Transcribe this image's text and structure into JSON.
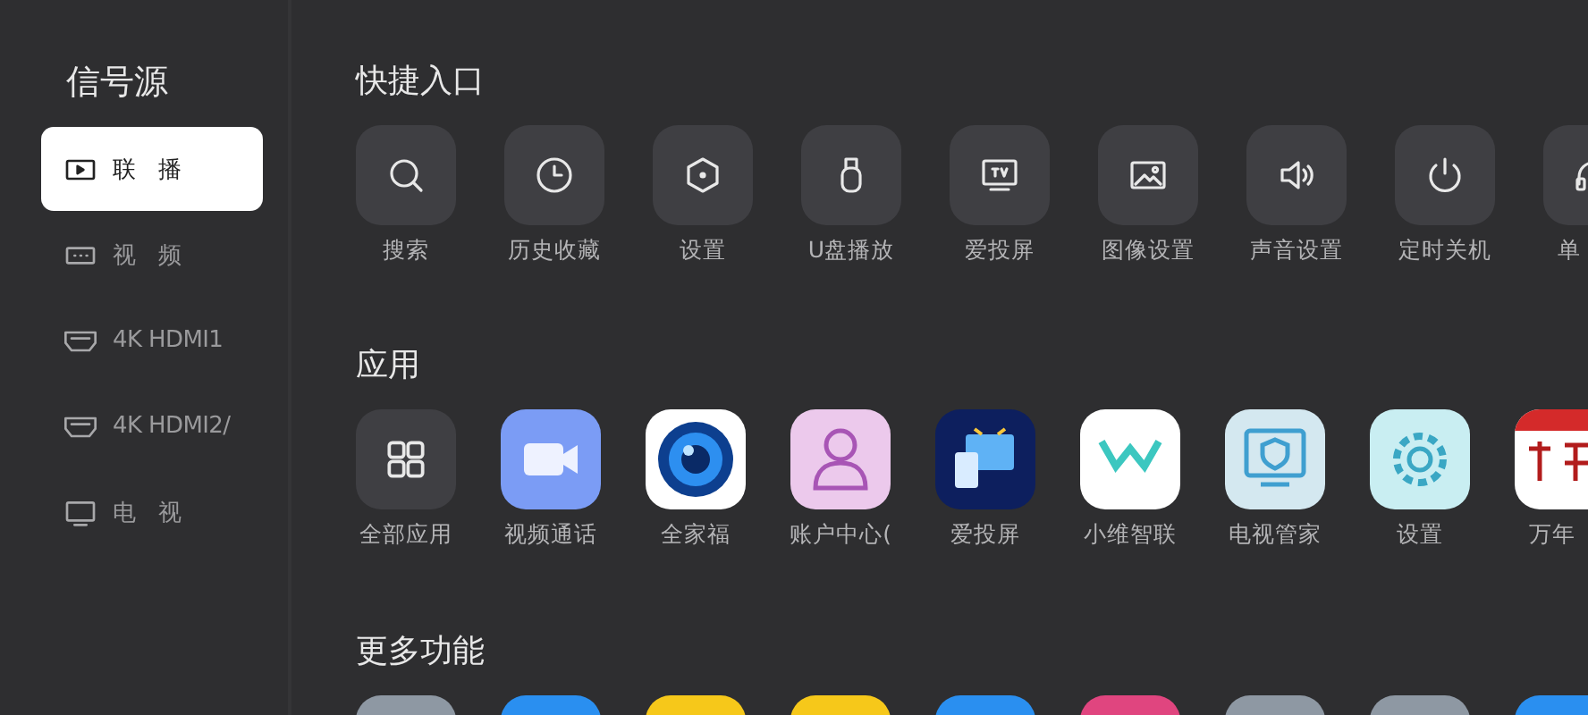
{
  "sidebar": {
    "title": "信号源",
    "items": [
      {
        "label": "联　播",
        "selected": true
      },
      {
        "label": "视　频",
        "selected": false
      },
      {
        "label": "4K HDMI1",
        "selected": false
      },
      {
        "label": "4K HDMI2/",
        "selected": false
      },
      {
        "label": "电　视",
        "selected": false
      }
    ]
  },
  "quick_access": {
    "title": "快捷入口",
    "items": [
      {
        "label": "搜索"
      },
      {
        "label": "历史收藏"
      },
      {
        "label": "设置"
      },
      {
        "label": "U盘播放"
      },
      {
        "label": "爱投屏"
      },
      {
        "label": "图像设置"
      },
      {
        "label": "声音设置"
      },
      {
        "label": "定时关机"
      },
      {
        "label": "单"
      }
    ]
  },
  "apps": {
    "title": "应用",
    "items": [
      {
        "label": "全部应用"
      },
      {
        "label": "视频通话"
      },
      {
        "label": "全家福"
      },
      {
        "label": "账户中心("
      },
      {
        "label": "爱投屏"
      },
      {
        "label": "小维智联"
      },
      {
        "label": "电视管家"
      },
      {
        "label": "设置"
      },
      {
        "label": "万年"
      }
    ]
  },
  "more_features": {
    "title": "更多功能",
    "items": [
      {
        "color": "#8e98a3"
      },
      {
        "color": "#2a8ff0"
      },
      {
        "color": "#f6c81a"
      },
      {
        "color": "#f6c81a"
      },
      {
        "color": "#2a8ff0"
      },
      {
        "color": "#e0457f"
      },
      {
        "color": "#8e98a3"
      },
      {
        "color": "#8e98a3"
      },
      {
        "color": "#2a8ff0"
      }
    ]
  }
}
